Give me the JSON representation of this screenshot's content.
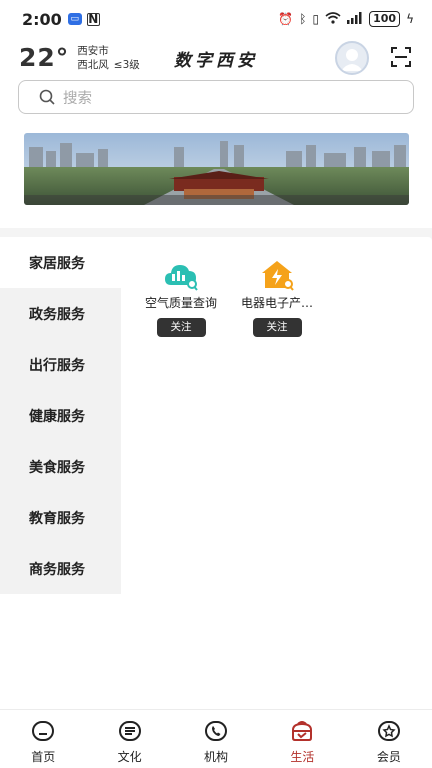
{
  "status_bar": {
    "time": "2:00",
    "battery": "100"
  },
  "header": {
    "temperature": "22°",
    "city": "西安市",
    "wind": "西北风",
    "wind_level": "≤3级",
    "app_title": "数字西安"
  },
  "search": {
    "placeholder": "搜索"
  },
  "side_nav": {
    "items": [
      {
        "label": "家居服务"
      },
      {
        "label": "政务服务"
      },
      {
        "label": "出行服务"
      },
      {
        "label": "健康服务"
      },
      {
        "label": "美食服务"
      },
      {
        "label": "教育服务"
      },
      {
        "label": "商务服务"
      }
    ]
  },
  "services": [
    {
      "name": "空气质量查询",
      "icon": "cloud-icon",
      "follow_label": "关注"
    },
    {
      "name": "电器电子产…",
      "icon": "house-bolt-icon",
      "follow_label": "关注"
    }
  ],
  "tab_bar": {
    "items": [
      {
        "label": "首页",
        "icon": "home-icon"
      },
      {
        "label": "文化",
        "icon": "culture-icon"
      },
      {
        "label": "机构",
        "icon": "phone-icon"
      },
      {
        "label": "生活",
        "icon": "life-icon"
      },
      {
        "label": "会员",
        "icon": "member-icon"
      }
    ]
  },
  "colors": {
    "accent": "#b3312b",
    "service_icon_teal": "#2bbfb3",
    "service_icon_orange": "#f5a21a"
  }
}
